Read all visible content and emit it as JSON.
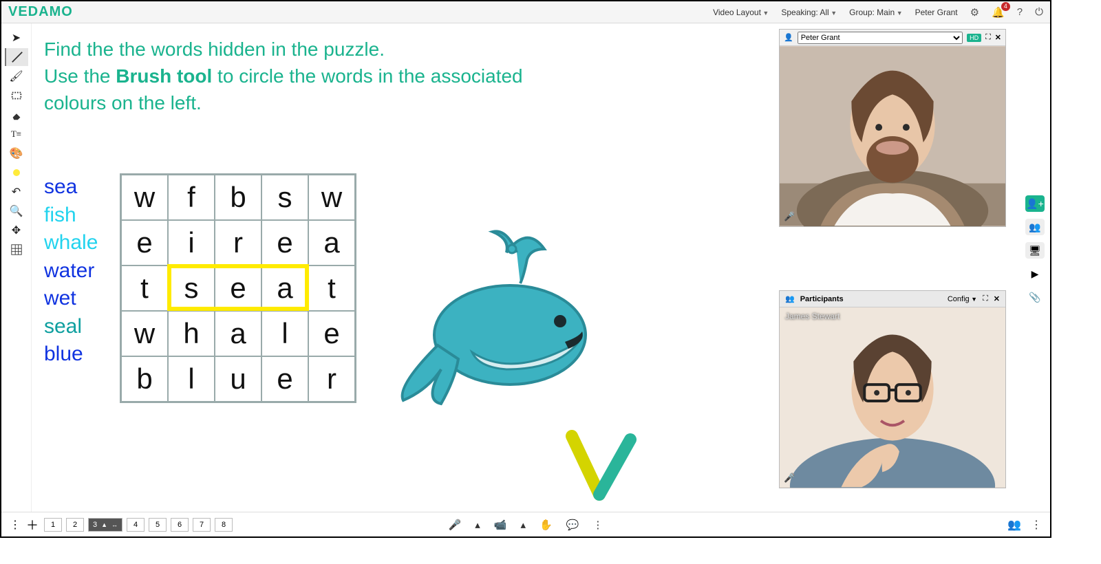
{
  "brand": "VEDAMO",
  "topbar": {
    "video_layout": "Video Layout",
    "speaking": "Speaking: All",
    "group": "Group: Main",
    "user": "Peter Grant",
    "notif_count": "4"
  },
  "instruction": {
    "line1": "Find the the words hidden in the puzzle.",
    "line2a": "Use the ",
    "line2b": "Brush tool",
    "line2c": " to circle the words in the associated",
    "line3": "colours on the left."
  },
  "words": [
    {
      "text": "sea",
      "class": "c-blue"
    },
    {
      "text": "fish",
      "class": "c-cyan"
    },
    {
      "text": "whale",
      "class": "c-cyan"
    },
    {
      "text": "water",
      "class": "c-blue"
    },
    {
      "text": "wet",
      "class": "c-blue"
    },
    {
      "text": "seal",
      "class": "c-teal"
    },
    {
      "text": "blue",
      "class": "c-blue"
    }
  ],
  "grid": [
    [
      "w",
      "f",
      "b",
      "s",
      "w"
    ],
    [
      "e",
      "i",
      "r",
      "e",
      "a"
    ],
    [
      "t",
      "s",
      "e",
      "a",
      "t"
    ],
    [
      "w",
      "h",
      "a",
      "l",
      "e"
    ],
    [
      "b",
      "l",
      "u",
      "e",
      "r"
    ]
  ],
  "pages": [
    "1",
    "2",
    "3",
    "4",
    "5",
    "6",
    "7",
    "8"
  ],
  "active_page": "3",
  "video": {
    "select": "Peter Grant",
    "hd": "HD"
  },
  "participants": {
    "title": "Participants",
    "config": "Config",
    "name_overlay": "James Stewart"
  }
}
